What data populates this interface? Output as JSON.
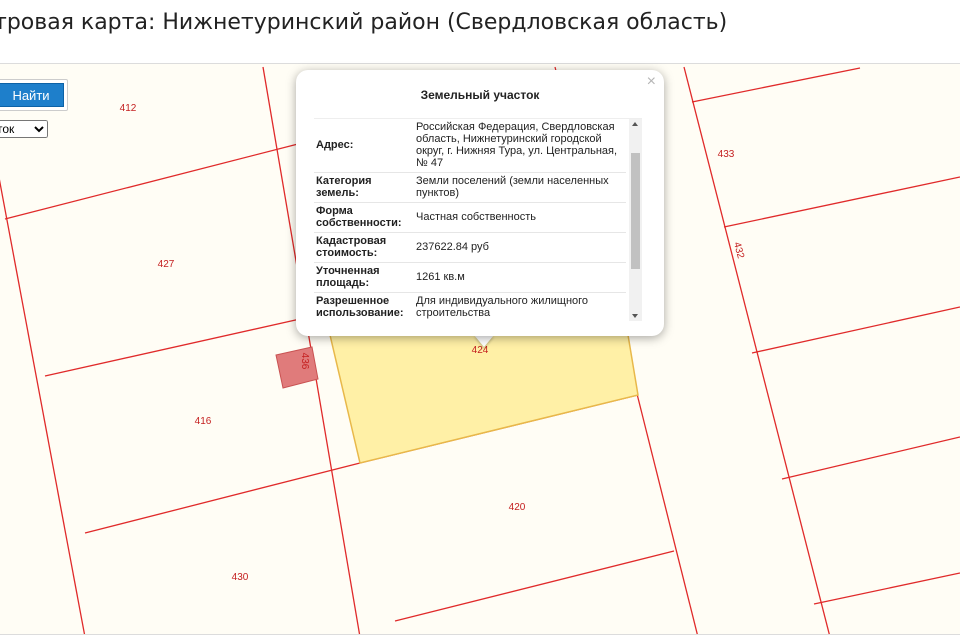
{
  "page": {
    "title": "тровая карта: Нижнетуринский район (Свердловская область)"
  },
  "search": {
    "find_button": "Найти",
    "type_select": "ток"
  },
  "map": {
    "parcel_labels": [
      "412",
      "427",
      "416",
      "430",
      "420",
      "424",
      "436",
      "433",
      "432"
    ],
    "colors": {
      "boundary": "#e02a2a",
      "label": "#c41f1f",
      "selected_fill": "#fff0a6",
      "selected_stroke": "#e8b84a",
      "small_parcel_fill": "#e07b7b",
      "background": "#fffdf5"
    }
  },
  "popup": {
    "title": "Земельный участок",
    "rows": [
      {
        "key": "Адрес:",
        "value": "Российская Федерация, Свердловская область, Нижнетуринский городской округ, г. Нижняя Тура, ул. Центральная, № 47"
      },
      {
        "key": "Категория земель:",
        "value": "Земли поселений (земли населенных пунктов)"
      },
      {
        "key": "Форма собственности:",
        "value": "Частная собственность"
      },
      {
        "key": "Кадастровая стоимость:",
        "value": "237622.84 руб"
      },
      {
        "key": "Уточненная площадь:",
        "value": "1261 кв.м"
      },
      {
        "key": "Разрешенное использование:",
        "value": "Для индивидуального жилищного строительства"
      }
    ]
  }
}
